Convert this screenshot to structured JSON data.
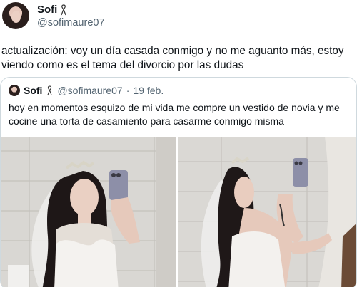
{
  "author": {
    "name": "Sofi",
    "handle": "@sofimaure07",
    "badge_icon": "ribbon-icon"
  },
  "tweet": {
    "text_line1": "actualización: voy un día casada conmigo y no me aguanto más, estoy",
    "text_line2": "viendo como es el tema del divorcio por las dudas"
  },
  "quoted": {
    "name": "Sofi",
    "handle": "@sofimaure07",
    "separator": "·",
    "date": "19 feb.",
    "text_line1": "hoy en momentos esquizo de mi vida me compre un vestido de novia y me",
    "text_line2": "cocine una torta de casamiento para casarme conmigo misma"
  },
  "colors": {
    "text": "#0f1419",
    "secondary": "#536471",
    "border": "#cfd9de"
  }
}
